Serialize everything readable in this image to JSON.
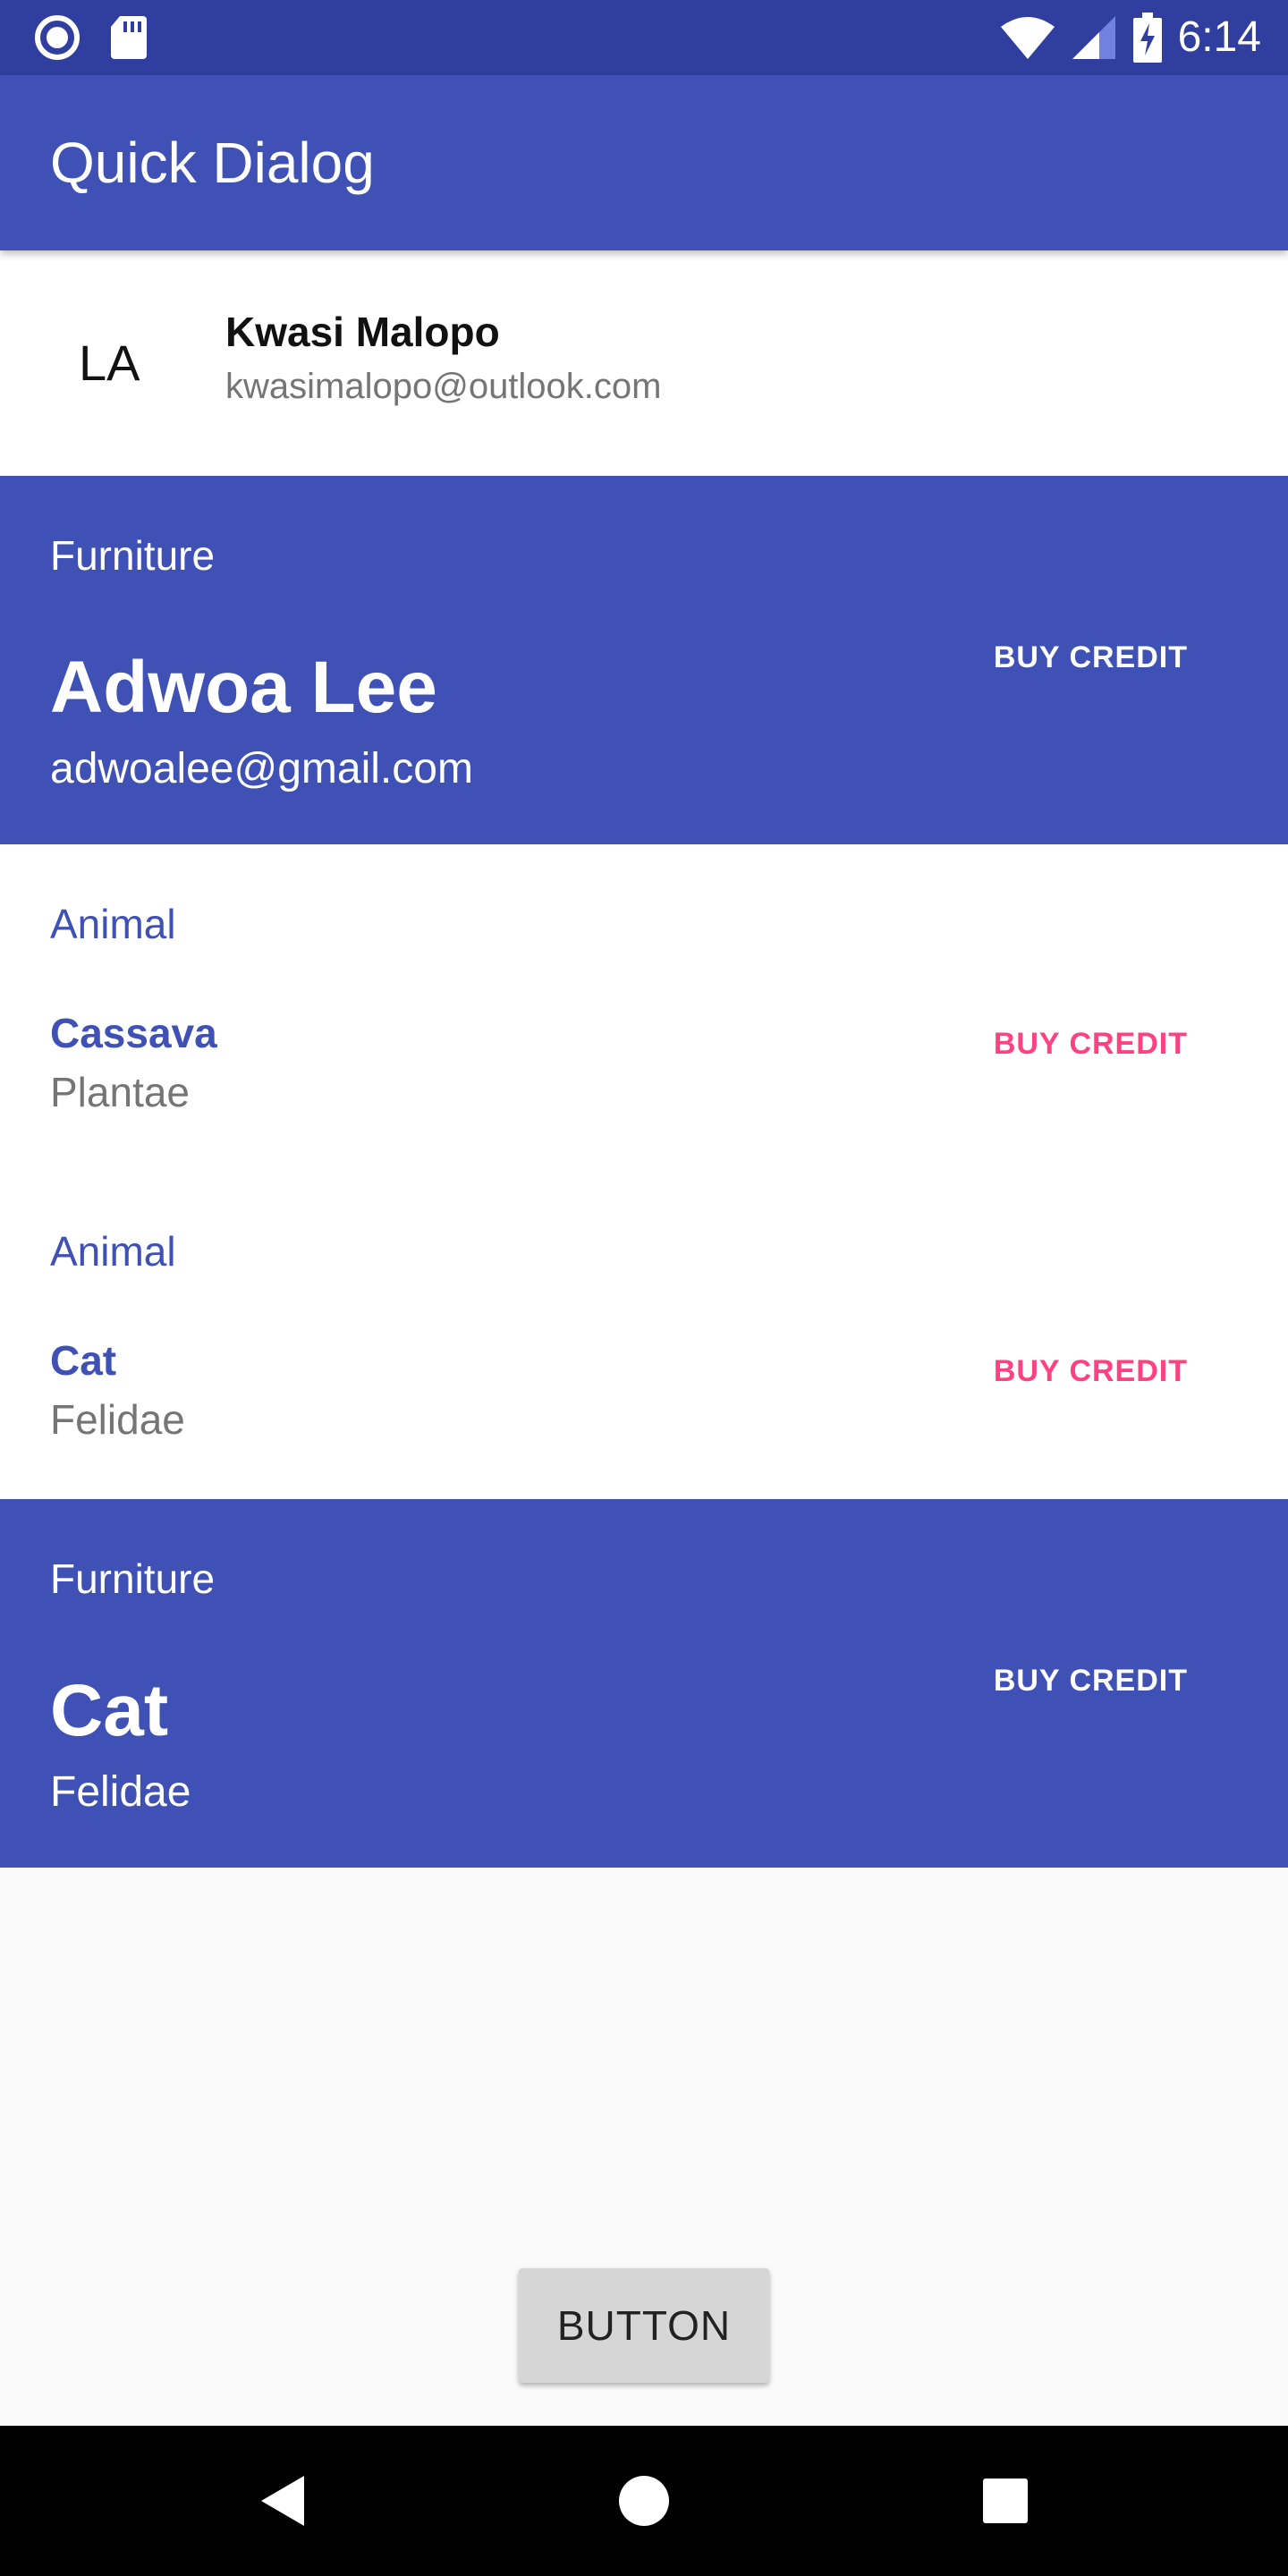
{
  "status_bar": {
    "time": "6:14",
    "icons": [
      "radio-icon",
      "sd-card-icon",
      "wifi-icon",
      "signal-icon",
      "battery-charging-icon"
    ]
  },
  "app_bar": {
    "title": "Quick Dialog"
  },
  "header": {
    "initials": "LA",
    "name": "Kwasi Malopo",
    "email": "kwasimalopo@outlook.com"
  },
  "rows": [
    {
      "category": "Furniture",
      "title": "Adwoa Lee",
      "subtitle": "adwoalee@gmail.com",
      "action": "BUY CREDIT"
    },
    {
      "category": "Animal",
      "title": "Cassava",
      "subtitle": "Plantae",
      "action": "BUY CREDIT"
    },
    {
      "category": "Animal",
      "title": "Cat",
      "subtitle": "Felidae",
      "action": "BUY CREDIT"
    },
    {
      "category": "Furniture",
      "title": "Cat",
      "subtitle": "Felidae",
      "action": "BUY CREDIT"
    }
  ],
  "main_button": {
    "label": "BUTTON"
  },
  "nav_bar": {
    "icons": [
      "back-icon",
      "home-icon",
      "recents-icon"
    ]
  },
  "colors": {
    "primary": "#3f51b5",
    "primary_dark": "#303f9f",
    "accent": "#ff4081",
    "background": "#fafafa"
  }
}
